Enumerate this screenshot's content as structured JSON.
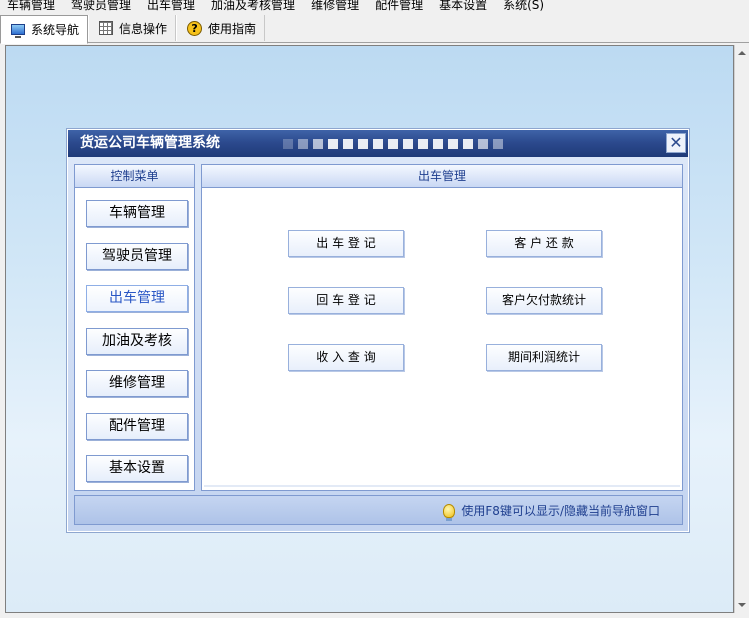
{
  "menu": [
    "车辆管理",
    "驾驶员管理",
    "出车管理",
    "加油及考核管理",
    "维修管理",
    "配件管理",
    "基本设置",
    "系统(S)"
  ],
  "tabs": [
    {
      "label": "系统导航",
      "icon": "monitor-icon",
      "active": true
    },
    {
      "label": "信息操作",
      "icon": "grid-icon",
      "active": false
    },
    {
      "label": "使用指南",
      "icon": "help-icon",
      "active": false
    }
  ],
  "dialog": {
    "title": "货运公司车辆管理系统",
    "close_label": "✕",
    "left_panel_title": "控制菜单",
    "main_panel_title": "出车管理",
    "control_buttons": [
      "车辆管理",
      "驾驶员管理",
      "出车管理",
      "加油及考核",
      "维修管理",
      "配件管理",
      "基本设置"
    ],
    "active_control": "出车管理",
    "action_buttons": [
      "出 车 登 记",
      "客 户 还 款",
      "回 车 登 记",
      "客户欠付款统计",
      "收 入 查 询",
      "期间利润统计"
    ],
    "status_tip": "使用F8键可以显示/隐藏当前导航窗口"
  },
  "colors": {
    "title_bar": "#2c4a8e",
    "panel_border": "#7f9ad0",
    "active_text": "#2a57c5",
    "workspace": "#d2e7f7"
  }
}
